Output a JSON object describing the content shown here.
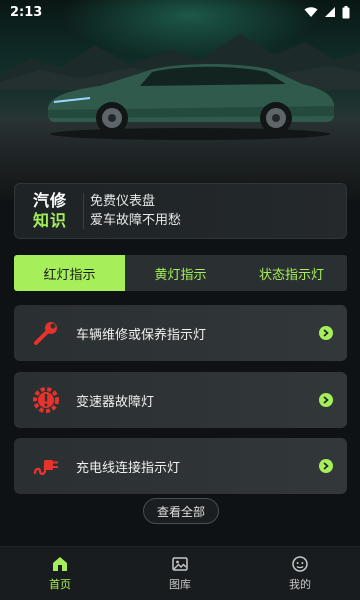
{
  "status_bar": {
    "time": "2:13"
  },
  "promo": {
    "title_line1": "汽修",
    "title_line2": "知识",
    "text_line1": "免费仪表盘",
    "text_line2": "爱车故障不用愁"
  },
  "tabs": [
    {
      "label": "红灯指示",
      "active": true
    },
    {
      "label": "黄灯指示",
      "active": false
    },
    {
      "label": "状态指示灯",
      "active": false
    }
  ],
  "items": [
    {
      "label": "车辆维修或保养指示灯",
      "icon": "wrench-icon"
    },
    {
      "label": "变速器故障灯",
      "icon": "gear-warning-icon"
    },
    {
      "label": "充电线连接指示灯",
      "icon": "charging-plug-icon"
    }
  ],
  "view_all_label": "查看全部",
  "bottom_nav": [
    {
      "label": "首页",
      "icon": "home-icon",
      "active": true
    },
    {
      "label": "图库",
      "icon": "gallery-icon",
      "active": false
    },
    {
      "label": "我的",
      "icon": "profile-icon",
      "active": false
    }
  ],
  "colors": {
    "accent": "#a6ee5a",
    "icon_red": "#e8332c",
    "background": "#0e1214"
  }
}
